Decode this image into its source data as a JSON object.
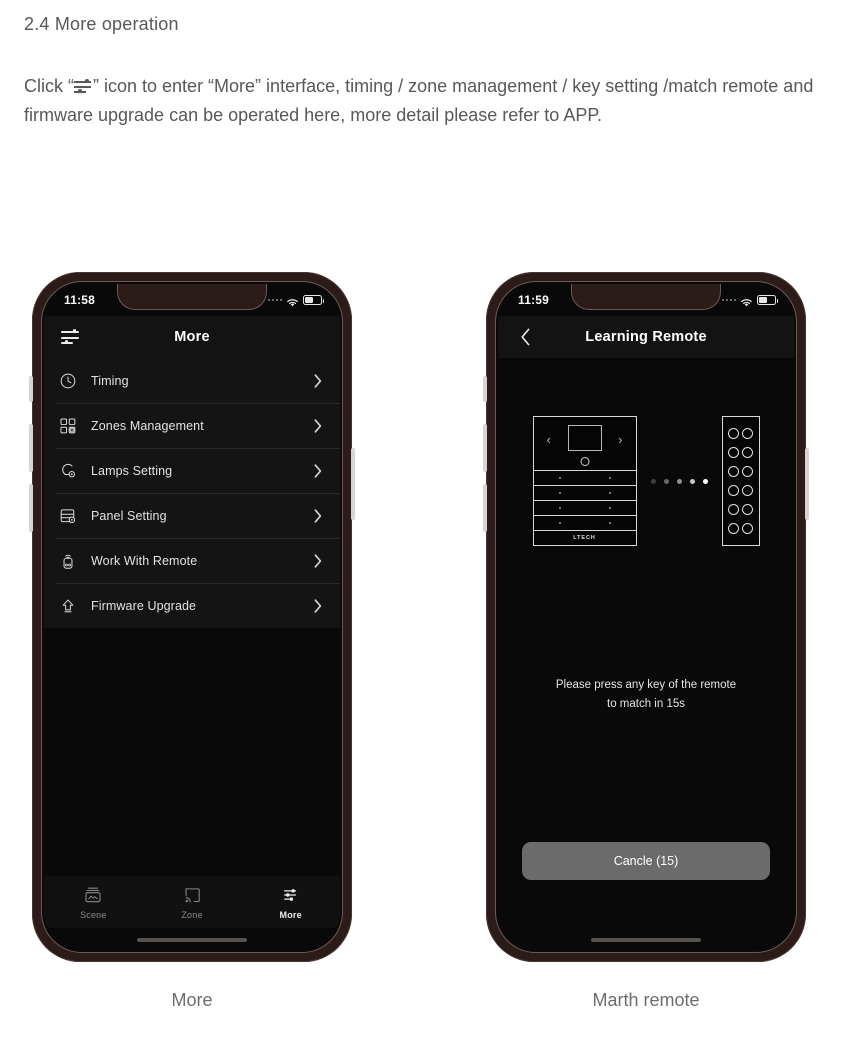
{
  "document": {
    "heading": "2.4 More operation",
    "body_before_icon": "Click “",
    "body_after_icon": "” icon to enter “More” interface, timing / zone management / key setting /match remote and firmware upgrade can be operated here, more detail please refer to APP.",
    "inline_icon_name": "sliders-icon"
  },
  "phone_left": {
    "caption": "More",
    "status": {
      "time": "11:58",
      "signal": "signal-dots",
      "wifi": "wifi-icon",
      "battery": "battery-icon"
    },
    "navbar": {
      "title": "More",
      "menu_icon": "hamburger-icon"
    },
    "menu": [
      {
        "label": "Timing",
        "icon": "clock-icon"
      },
      {
        "label": "Zones Management",
        "icon": "grid-settings-icon"
      },
      {
        "label": "Lamps Setting",
        "icon": "lamp-settings-icon"
      },
      {
        "label": "Panel Setting",
        "icon": "panel-settings-icon"
      },
      {
        "label": "Work With Remote",
        "icon": "remote-signal-icon"
      },
      {
        "label": "Firmware Upgrade",
        "icon": "upload-arrow-icon"
      }
    ],
    "tabs": [
      {
        "label": "Scene",
        "icon": "scene-icon",
        "active": false
      },
      {
        "label": "Zone",
        "icon": "zone-cast-icon",
        "active": false
      },
      {
        "label": "More",
        "icon": "sliders-icon",
        "active": true
      }
    ]
  },
  "phone_right": {
    "caption": "Marth remote",
    "status": {
      "time": "11:59",
      "signal": "signal-dots",
      "wifi": "wifi-icon",
      "battery": "battery-icon"
    },
    "navbar": {
      "title": "Learning Remote",
      "back_icon": "chevron-left-icon"
    },
    "graphic": {
      "panel_brand": "LTECH",
      "panel_rows": 4,
      "panel_arrow_left": "‹",
      "panel_arrow_right": "›",
      "dots_count": 5,
      "remote_buttons": 12
    },
    "instruction_line1": "Please press any key of the remote",
    "instruction_line2": "to match in 15s",
    "cancel_label": "Cancle (15)"
  },
  "colors": {
    "page_bg": "#ffffff",
    "text_gray": "#58585a",
    "phone_frame": "#2b1c1a",
    "screen_bg": "#0a0909",
    "list_bg": "#151414",
    "cancel_bg": "#6b6b6b"
  }
}
